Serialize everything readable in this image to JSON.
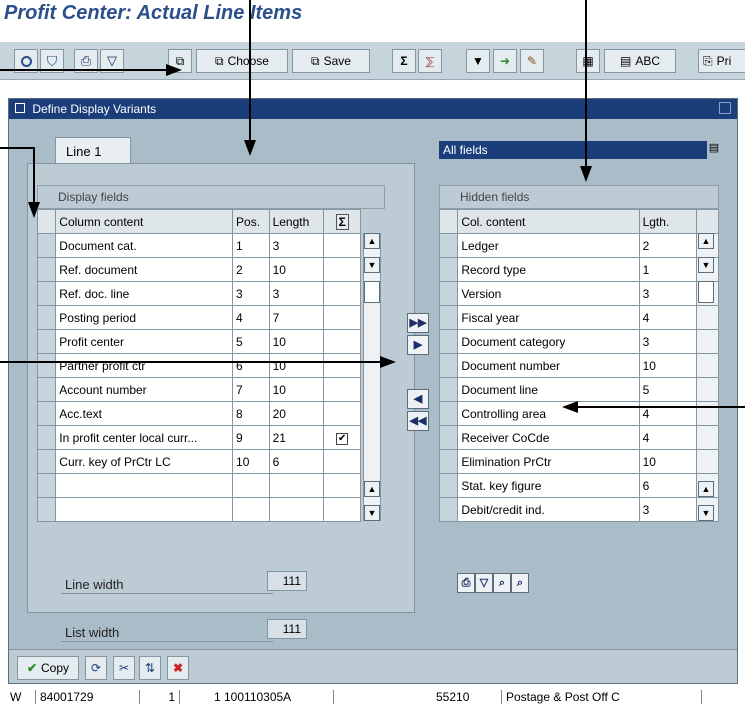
{
  "app": {
    "title": "Profit Center: Actual Line Items"
  },
  "toolbar": {
    "choose_label": "Choose",
    "save_label": "Save",
    "abc_label": "ABC",
    "print_label": "Pri"
  },
  "dialog": {
    "title": "Define Display Variants",
    "tab_label": "Line 1",
    "dropdown_value": "All fields",
    "display_fields_header": "Display fields",
    "hidden_fields_header": "Hidden fields",
    "display_columns": [
      "Column content",
      "Pos.",
      "Length"
    ],
    "display_rows": [
      {
        "content": "Document cat.",
        "pos": "1",
        "len": "3",
        "check": ""
      },
      {
        "content": "Ref. document",
        "pos": "2",
        "len": "10",
        "check": ""
      },
      {
        "content": "Ref. doc. line",
        "pos": "3",
        "len": "3",
        "check": ""
      },
      {
        "content": "Posting period",
        "pos": "4",
        "len": "7",
        "check": ""
      },
      {
        "content": "Profit center",
        "pos": "5",
        "len": "10",
        "check": ""
      },
      {
        "content": "Partner profit ctr",
        "pos": "6",
        "len": "10",
        "check": ""
      },
      {
        "content": "Account number",
        "pos": "7",
        "len": "10",
        "check": ""
      },
      {
        "content": "Acc.text",
        "pos": "8",
        "len": "20",
        "check": ""
      },
      {
        "content": "In profit center local curr...",
        "pos": "9",
        "len": "21",
        "check": "✔"
      },
      {
        "content": "Curr. key of PrCtr LC",
        "pos": "10",
        "len": "6",
        "check": ""
      },
      {
        "content": "",
        "pos": "",
        "len": "",
        "check": ""
      },
      {
        "content": "",
        "pos": "",
        "len": "",
        "check": ""
      }
    ],
    "hidden_columns": [
      "Col. content",
      "Lgth."
    ],
    "hidden_rows": [
      {
        "content": "Ledger",
        "len": "2"
      },
      {
        "content": "Record type",
        "len": "1"
      },
      {
        "content": "Version",
        "len": "3"
      },
      {
        "content": "Fiscal year",
        "len": "4"
      },
      {
        "content": "Document category",
        "len": "3"
      },
      {
        "content": "Document number",
        "len": "10"
      },
      {
        "content": "Document line",
        "len": "5"
      },
      {
        "content": "Controlling area",
        "len": "4"
      },
      {
        "content": "Receiver CoCde",
        "len": "4"
      },
      {
        "content": "Elimination PrCtr",
        "len": "10"
      },
      {
        "content": "Stat. key figure",
        "len": "6"
      },
      {
        "content": "Debit/credit ind.",
        "len": "3"
      }
    ],
    "line_width_label": "Line width",
    "line_width_value": "111",
    "list_width_label": "List width",
    "list_width_value": "111",
    "copy_label": "Copy"
  },
  "background_row": {
    "c1": "W",
    "c2": "84001729",
    "c3": "1",
    "c4": "1 100110305A",
    "c5": "55210",
    "c6": "Postage & Post Off C"
  }
}
